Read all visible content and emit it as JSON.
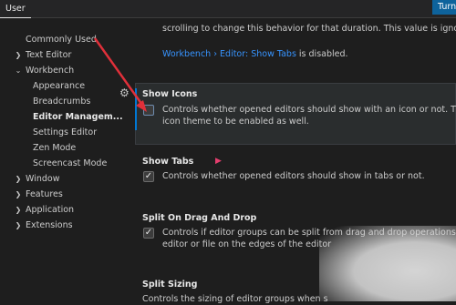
{
  "header": {
    "tab_user": "User",
    "turn_button": "Turn"
  },
  "sidebar": {
    "items": [
      {
        "label": "Commonly Used"
      },
      {
        "label": "Text Editor"
      },
      {
        "label": "Workbench"
      },
      {
        "label": "Appearance"
      },
      {
        "label": "Breadcrumbs"
      },
      {
        "label": "Editor Managem..."
      },
      {
        "label": "Settings Editor"
      },
      {
        "label": "Zen Mode"
      },
      {
        "label": "Screencast Mode"
      },
      {
        "label": "Window"
      },
      {
        "label": "Features"
      },
      {
        "label": "Application"
      },
      {
        "label": "Extensions"
      }
    ]
  },
  "settings": {
    "prev_desc_line1": "scrolling to change this behavior for that duration. This value is ignored",
    "prev_desc_link": "Workbench › Editor: Show Tabs",
    "prev_desc_line2_suffix": " is disabled.",
    "show_icons": {
      "title": "Show Icons",
      "desc_line1": "Controls whether opened editors should show with an icon or not. This r",
      "desc_line2": "icon theme to be enabled as well."
    },
    "show_tabs": {
      "title": "Show Tabs",
      "desc": "Controls whether opened editors should show in tabs or not."
    },
    "split_on_drag": {
      "title": "Split On Drag And Drop",
      "desc_line1": "Controls if editor groups can be split from drag and drop operations by",
      "desc_line2": "editor or file on the edges of the editor"
    },
    "split_sizing": {
      "title": "Split Sizing",
      "desc": "Controls the sizing of editor groups when s"
    }
  },
  "colors": {
    "background": "#1e1e1e",
    "accent": "#0e639c",
    "link": "#3794ff",
    "annotation_arrow": "#e0303a"
  }
}
